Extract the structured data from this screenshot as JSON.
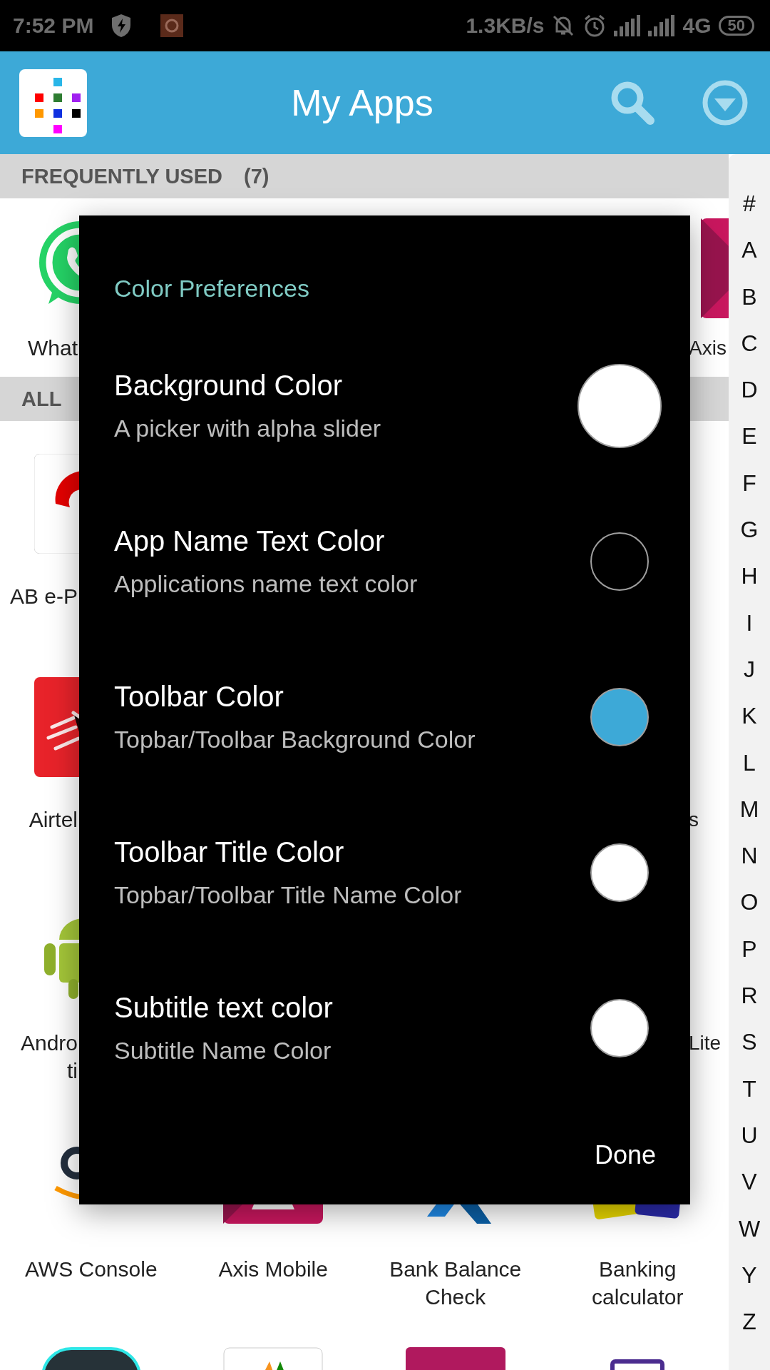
{
  "status_bar": {
    "time": "7:52 PM",
    "speed": "1.3KB/s",
    "network": "4G",
    "battery": "50"
  },
  "toolbar": {
    "title": "My Apps"
  },
  "frequently_used": {
    "heading": "FREQUENTLY USED",
    "count": "(7)",
    "cells": [
      {
        "left": {
          "lines": [
            "What"
          ]
        },
        "right": {
          "lines": [
            "Axis"
          ]
        }
      }
    ]
  },
  "all": {
    "heading": "ALL",
    "partial_rows": [
      {
        "left": {
          "lines": [
            "AB e-P"
          ]
        }
      },
      {
        "left": {
          "lines": [
            "Airtel"
          ]
        },
        "right": {
          "lines": [
            "s"
          ]
        }
      },
      {
        "left": {
          "lines": [
            "Andro",
            "ti"
          ]
        },
        "right": {
          "lines": [
            "Lite"
          ]
        }
      }
    ],
    "full_row": [
      {
        "lines": [
          "AWS Console"
        ]
      },
      {
        "lines": [
          "Axis Mobile"
        ]
      },
      {
        "lines": [
          "Bank Balance",
          "Check"
        ]
      },
      {
        "lines": [
          "Banking",
          "calculator"
        ]
      }
    ]
  },
  "index_bar": [
    "#",
    "A",
    "B",
    "C",
    "D",
    "E",
    "F",
    "G",
    "H",
    "I",
    "J",
    "K",
    "L",
    "M",
    "N",
    "O",
    "P",
    "R",
    "S",
    "T",
    "U",
    "V",
    "W",
    "Y",
    "Z"
  ],
  "dialog": {
    "title": "Color Preferences",
    "items": [
      {
        "kind": "large",
        "title": "Background Color",
        "subtitle": "A picker with alpha slider",
        "color": "#ffffff"
      },
      {
        "kind": "small",
        "title": "App Name Text Color",
        "subtitle": "Applications name text color",
        "color": "#000000"
      },
      {
        "kind": "small",
        "title": "Toolbar Color",
        "subtitle": "Topbar/Toolbar Background Color",
        "color": "#3da9d7"
      },
      {
        "kind": "small",
        "title": "Toolbar Title Color",
        "subtitle": "Topbar/Toolbar Title Name Color",
        "color": "#ffffff"
      },
      {
        "kind": "small",
        "title": "Subtitle text color",
        "subtitle": "Subtitle Name Color",
        "color": "#ffffff"
      }
    ],
    "button": "Done"
  }
}
